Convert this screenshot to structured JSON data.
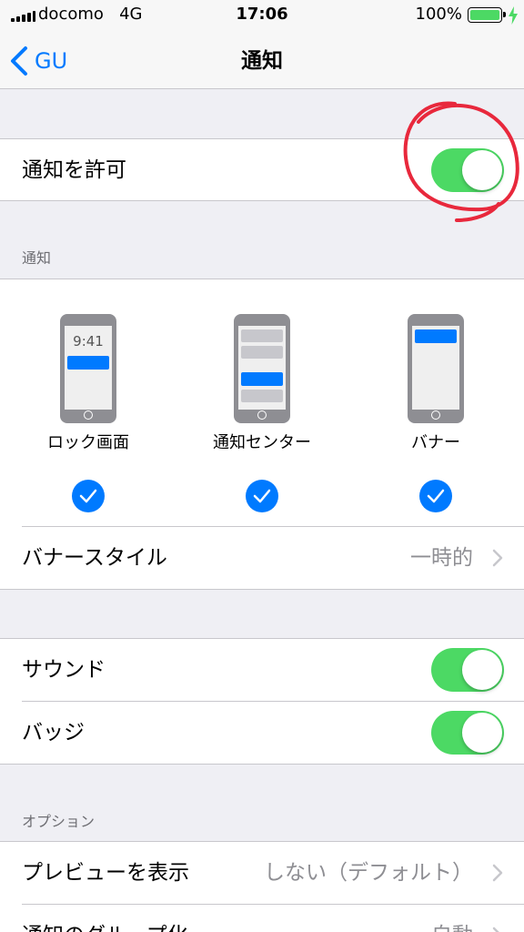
{
  "status_bar": {
    "carrier": "docomo",
    "network": "4G",
    "time": "17:06",
    "battery": "100%",
    "battery_level": 1.0,
    "battery_color": "#4cd964"
  },
  "nav": {
    "back_label": "GU",
    "title": "通知"
  },
  "allow_notifications": {
    "label": "通知を許可",
    "on": true
  },
  "alerts": {
    "header": "通知",
    "styles": [
      {
        "label": "ロック画面",
        "checked": true,
        "preview_time": "9:41"
      },
      {
        "label": "通知センター",
        "checked": true
      },
      {
        "label": "バナー",
        "checked": true
      }
    ],
    "banner_style": {
      "label": "バナースタイル",
      "value": "一時的"
    }
  },
  "sound_badge": {
    "sound": {
      "label": "サウンド",
      "on": true
    },
    "badge": {
      "label": "バッジ",
      "on": true
    }
  },
  "options": {
    "header": "オプション",
    "preview": {
      "label": "プレビューを表示",
      "value": "しない（デフォルト）"
    },
    "grouping": {
      "label": "通知のグループ化",
      "value": "自動"
    }
  },
  "colors": {
    "accent": "#007aff",
    "toggle_on": "#4cd964",
    "annotation": "#e8283c"
  }
}
